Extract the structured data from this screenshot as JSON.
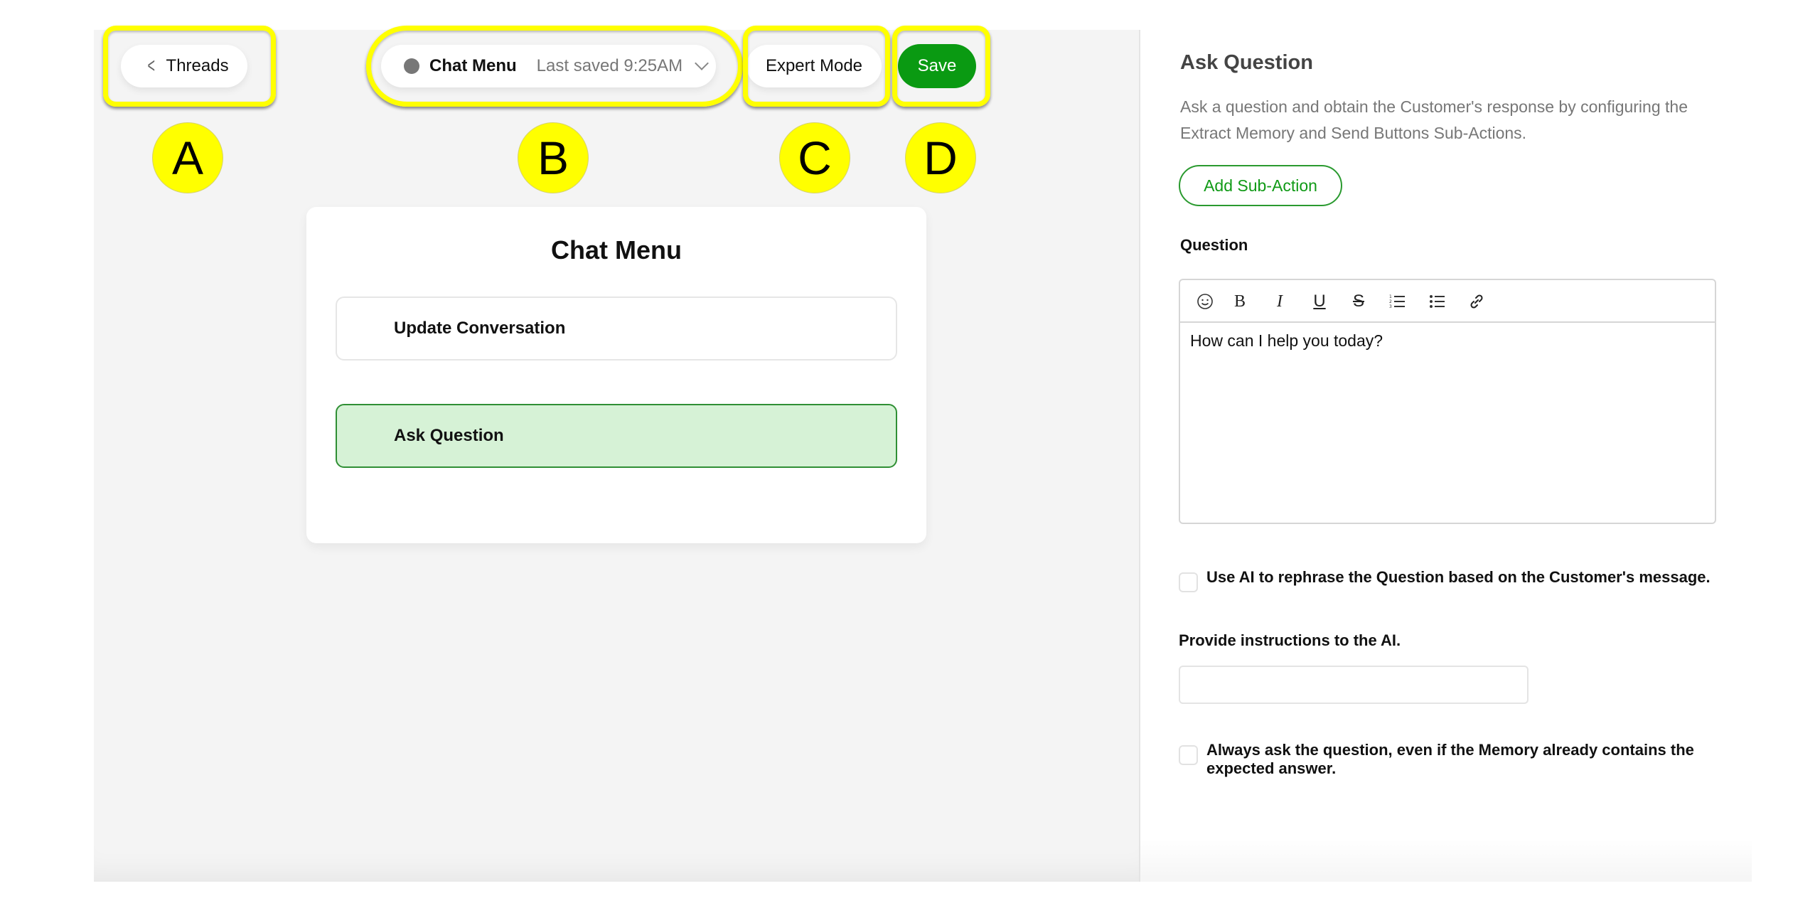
{
  "topbar": {
    "threads_label": "Threads",
    "chat_name": "Chat Menu",
    "last_saved": "Last saved 9:25AM",
    "status_color": "#777777",
    "expert_mode_label": "Expert Mode",
    "save_label": "Save",
    "save_color": "#0a9a12"
  },
  "annotations": [
    "A",
    "B",
    "C",
    "D"
  ],
  "card": {
    "title": "Chat Menu",
    "items": [
      {
        "label": "Update Conversation",
        "selected": false
      },
      {
        "label": "Ask Question",
        "selected": true
      }
    ]
  },
  "panel": {
    "title": "Ask Question",
    "description": "Ask a question and obtain the Customer's response by configuring the Extract Memory and Send Buttons Sub-Actions.",
    "add_sub_action_label": "Add Sub-Action",
    "question_label": "Question",
    "toolbar_icons": [
      "emoji-icon",
      "bold-icon",
      "italic-icon",
      "underline-icon",
      "strikethrough-icon",
      "ordered-list-icon",
      "bullet-list-icon",
      "link-icon"
    ],
    "question_text": "How can I help you today?",
    "rephrase_checkbox": {
      "label": "Use AI to rephrase the Question based on the Customer's message.",
      "checked": false
    },
    "instructions_label": "Provide instructions to the AI.",
    "instructions_value": "",
    "always_ask_checkbox": {
      "label": "Always ask the question, even if the Memory already contains the expected answer.",
      "checked": false
    }
  }
}
